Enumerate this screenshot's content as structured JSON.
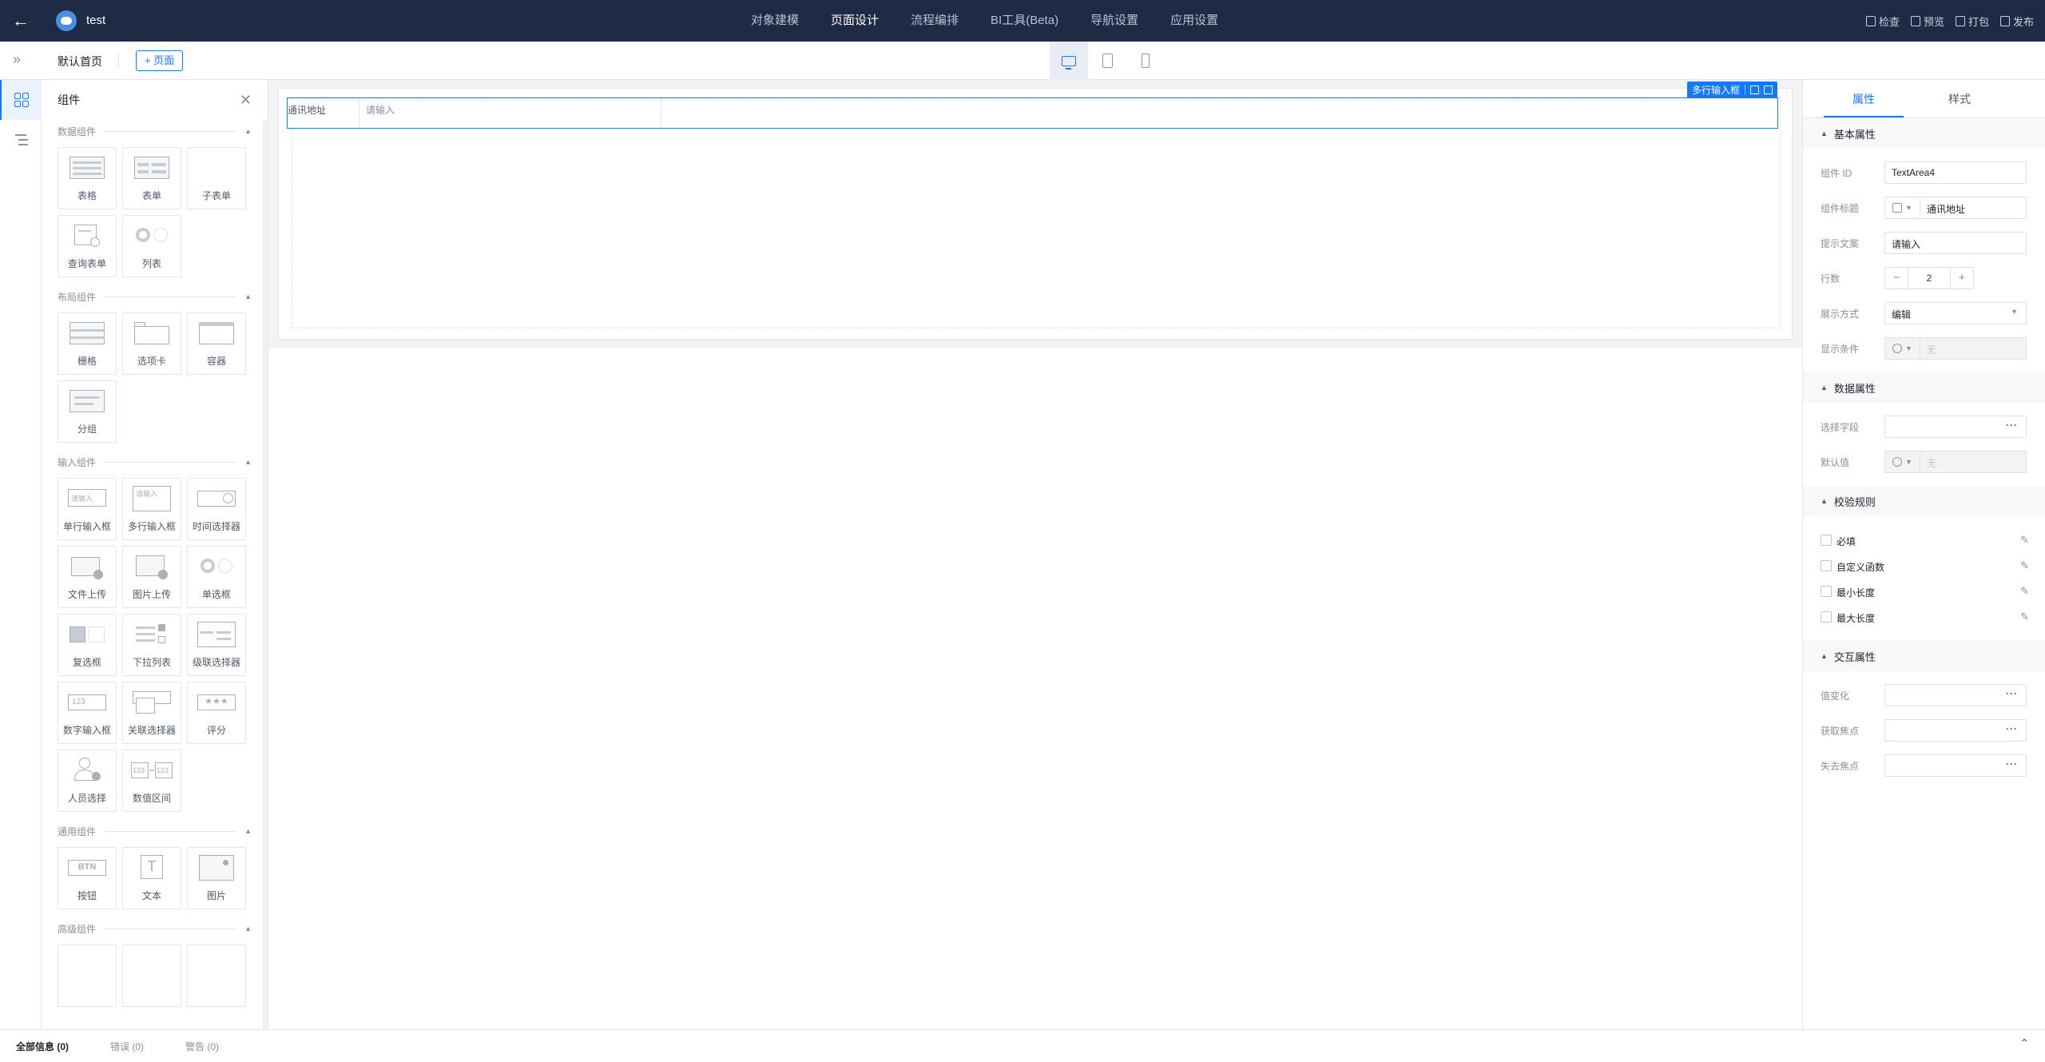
{
  "topbar": {
    "app_title": "test",
    "nav": [
      "对象建模",
      "页面设计",
      "流程编排",
      "BI工具(Beta)",
      "导航设置",
      "应用设置"
    ],
    "active_nav": 1,
    "actions": [
      "检查",
      "预览",
      "打包",
      "发布"
    ]
  },
  "subbar": {
    "page_name": "默认首页",
    "add_page": "+ 页面",
    "active_device": "desktop"
  },
  "components": {
    "title": "组件",
    "sections": [
      {
        "title": "数据组件",
        "items": [
          "表格",
          "表单",
          "子表单",
          "查询表单",
          "列表"
        ]
      },
      {
        "title": "布局组件",
        "items": [
          "栅格",
          "选项卡",
          "容器",
          "分组"
        ]
      },
      {
        "title": "输入组件",
        "items": [
          "单行输入框",
          "多行输入框",
          "时间选择器",
          "文件上传",
          "图片上传",
          "单选框",
          "复选框",
          "下拉列表",
          "级联选择器",
          "数字输入框",
          "关联选择器",
          "评分",
          "人员选择",
          "数值区间"
        ]
      },
      {
        "title": "通用组件",
        "items": [
          "按钮",
          "文本",
          "图片"
        ]
      },
      {
        "title": "高级组件",
        "items": []
      }
    ],
    "thumb_text": {
      "input": "请输入",
      "textarea": "请输入",
      "number": "123",
      "btn": "BTN",
      "text": "T"
    }
  },
  "canvas": {
    "selected_tag": "多行输入框",
    "field_label": "通讯地址",
    "field_placeholder": "请输入"
  },
  "properties": {
    "tabs": [
      "属性",
      "样式"
    ],
    "active_tab": 0,
    "groups": {
      "basic": "基本属性",
      "data": "数据属性",
      "validation": "校验规则",
      "interaction": "交互属性"
    },
    "component_id_label": "组件 ID",
    "component_id": "TextArea4",
    "title_label": "组件标题",
    "title_value": "通讯地址",
    "hint_label": "提示文案",
    "hint_value": "请输入",
    "rows_label": "行数",
    "rows_value": "2",
    "display_label": "展示方式",
    "display_value": "编辑",
    "condition_label": "显示条件",
    "condition_value": "无",
    "field_label": "选择字段",
    "default_label": "默认值",
    "default_value": "无",
    "rules": [
      "必填",
      "自定义函数",
      "最小长度",
      "最大长度"
    ],
    "events": [
      "值变化",
      "获取焦点",
      "失去焦点"
    ]
  },
  "bottombar": {
    "all": "全部信息 (0)",
    "errors": "错误 (0)",
    "warnings": "警告 (0)"
  }
}
